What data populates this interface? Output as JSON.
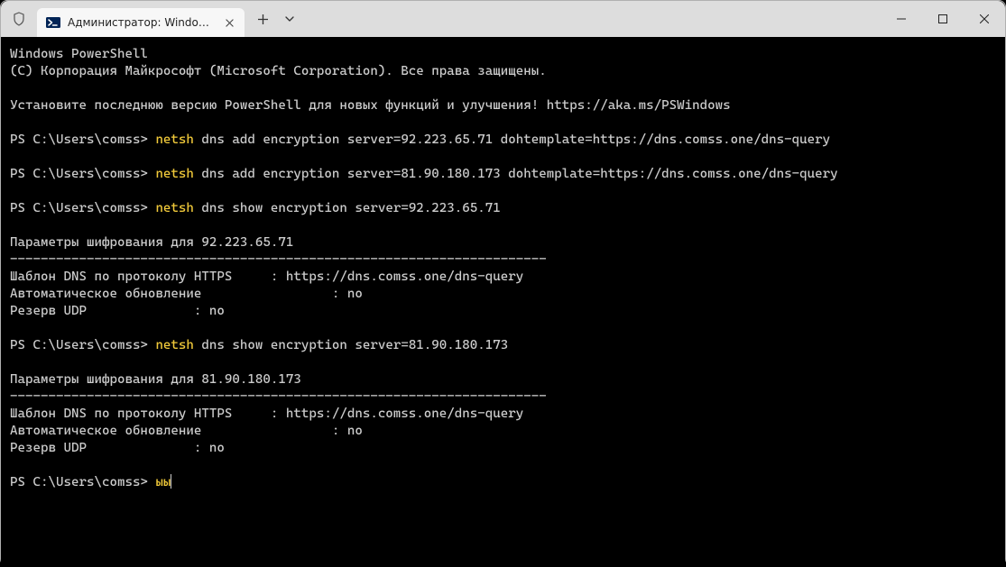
{
  "window": {
    "tab_title": "Администратор: Windows Po",
    "app_icon_name": "powershell-icon"
  },
  "colors": {
    "cmd_highlight": "#f0c93a",
    "terminal_bg": "#000000",
    "terminal_fg": "#cccccc",
    "titlebar_bg": "#dddddd",
    "tab_bg": "#f7f7f7"
  },
  "terminal": {
    "lines": [
      {
        "t": "plain",
        "text": "Windows PowerShell"
      },
      {
        "t": "plain",
        "text": "(C) Корпорация Майкрософт (Microsoft Corporation). Все права защищены."
      },
      {
        "t": "blank"
      },
      {
        "t": "plain",
        "text": "Установите последнюю версию PowerShell для новых функций и улучшения! https://aka.ms/PSWindows"
      },
      {
        "t": "blank"
      },
      {
        "t": "prompt",
        "prompt": "PS C:\\Users\\comss> ",
        "cmd": "netsh",
        "rest": " dns add encryption server=92.223.65.71 dohtemplate=https://dns.comss.one/dns-query"
      },
      {
        "t": "blank"
      },
      {
        "t": "prompt",
        "prompt": "PS C:\\Users\\comss> ",
        "cmd": "netsh",
        "rest": " dns add encryption server=81.90.180.173 dohtemplate=https://dns.comss.one/dns-query"
      },
      {
        "t": "blank"
      },
      {
        "t": "prompt",
        "prompt": "PS C:\\Users\\comss> ",
        "cmd": "netsh",
        "rest": " dns show encryption server=92.223.65.71"
      },
      {
        "t": "blank"
      },
      {
        "t": "plain",
        "text": "Параметры шифрования для 92.223.65.71"
      },
      {
        "t": "plain",
        "text": "----------------------------------------------------------------------"
      },
      {
        "t": "plain",
        "text": "Шаблон DNS по протоколу HTTPS     : https://dns.comss.one/dns-query"
      },
      {
        "t": "plain",
        "text": "Автоматическое обновление                 : no"
      },
      {
        "t": "plain",
        "text": "Резерв UDP              : no"
      },
      {
        "t": "blank"
      },
      {
        "t": "prompt",
        "prompt": "PS C:\\Users\\comss> ",
        "cmd": "netsh",
        "rest": " dns show encryption server=81.90.180.173"
      },
      {
        "t": "blank"
      },
      {
        "t": "plain",
        "text": "Параметры шифрования для 81.90.180.173"
      },
      {
        "t": "plain",
        "text": "----------------------------------------------------------------------"
      },
      {
        "t": "plain",
        "text": "Шаблон DNS по протоколу HTTPS     : https://dns.comss.one/dns-query"
      },
      {
        "t": "plain",
        "text": "Автоматическое обновление                 : no"
      },
      {
        "t": "plain",
        "text": "Резерв UDP              : no"
      },
      {
        "t": "blank"
      },
      {
        "t": "prompt_cursor",
        "prompt": "PS C:\\Users\\comss> ",
        "cmd": "ыы"
      }
    ]
  }
}
